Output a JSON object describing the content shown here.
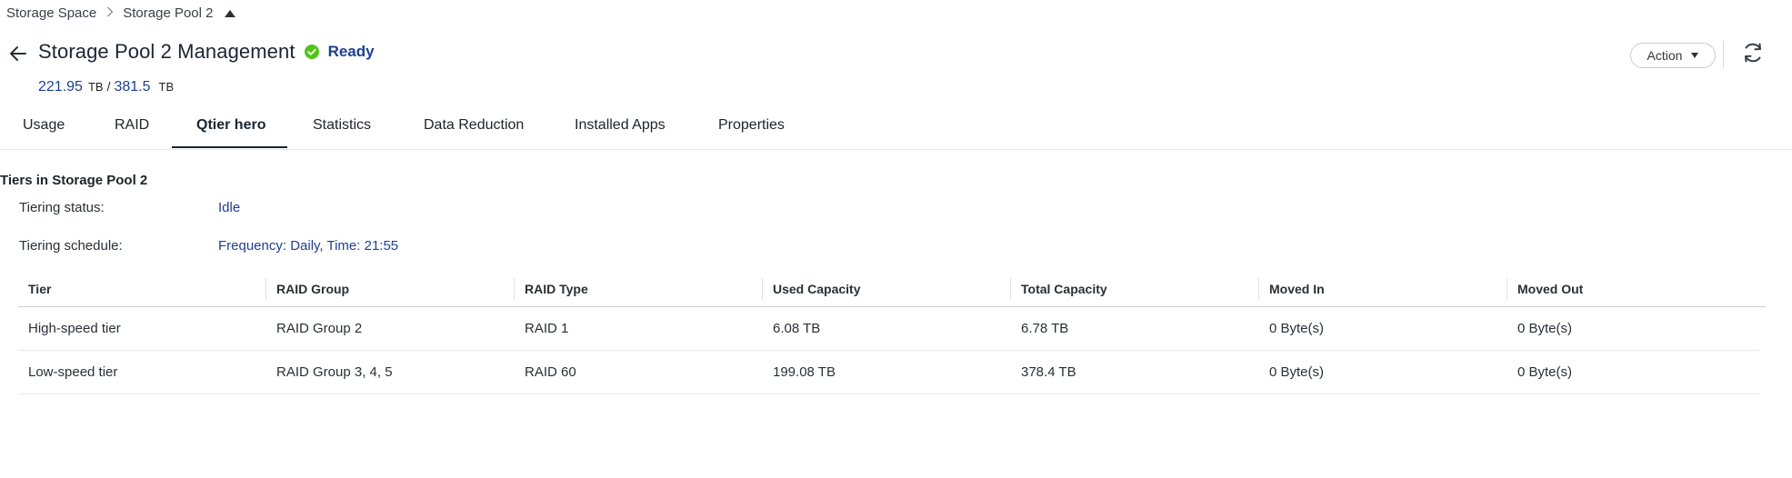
{
  "breadcrumb": {
    "items": [
      "Storage Space",
      "Storage Pool 2"
    ]
  },
  "header": {
    "title": "Storage Pool 2 Management",
    "status": "Ready",
    "status_color": "#52c41a",
    "capacity_used": "221.95",
    "capacity_used_unit": "TB",
    "capacity_sep": "/",
    "capacity_total": "381.5",
    "capacity_total_unit": "TB"
  },
  "toolbar": {
    "action_label": "Action"
  },
  "tabs": [
    {
      "label": "Usage"
    },
    {
      "label": "RAID"
    },
    {
      "label": "Qtier hero",
      "active": true
    },
    {
      "label": "Statistics"
    },
    {
      "label": "Data Reduction"
    },
    {
      "label": "Installed Apps"
    },
    {
      "label": "Properties"
    }
  ],
  "qtier": {
    "section_title": "Tiers in Storage Pool 2",
    "status_label": "Tiering status:",
    "status_value": "Idle",
    "schedule_label": "Tiering schedule:",
    "schedule_value": "Frequency: Daily, Time: 21:55"
  },
  "table": {
    "columns": [
      "Tier",
      "RAID Group",
      "RAID Type",
      "Used Capacity",
      "Total Capacity",
      "Moved In",
      "Moved Out"
    ],
    "rows": [
      [
        "High-speed tier",
        "RAID Group 2",
        "RAID 1",
        "6.08 TB",
        "6.78 TB",
        "0 Byte(s)",
        "0 Byte(s)"
      ],
      [
        "Low-speed tier",
        "RAID Group 3, 4, 5",
        "RAID 60",
        "199.08 TB",
        "378.4 TB",
        "0 Byte(s)",
        "0 Byte(s)"
      ]
    ]
  },
  "colors": {
    "accent": "#1d3f8f",
    "ready": "#52c41a"
  }
}
